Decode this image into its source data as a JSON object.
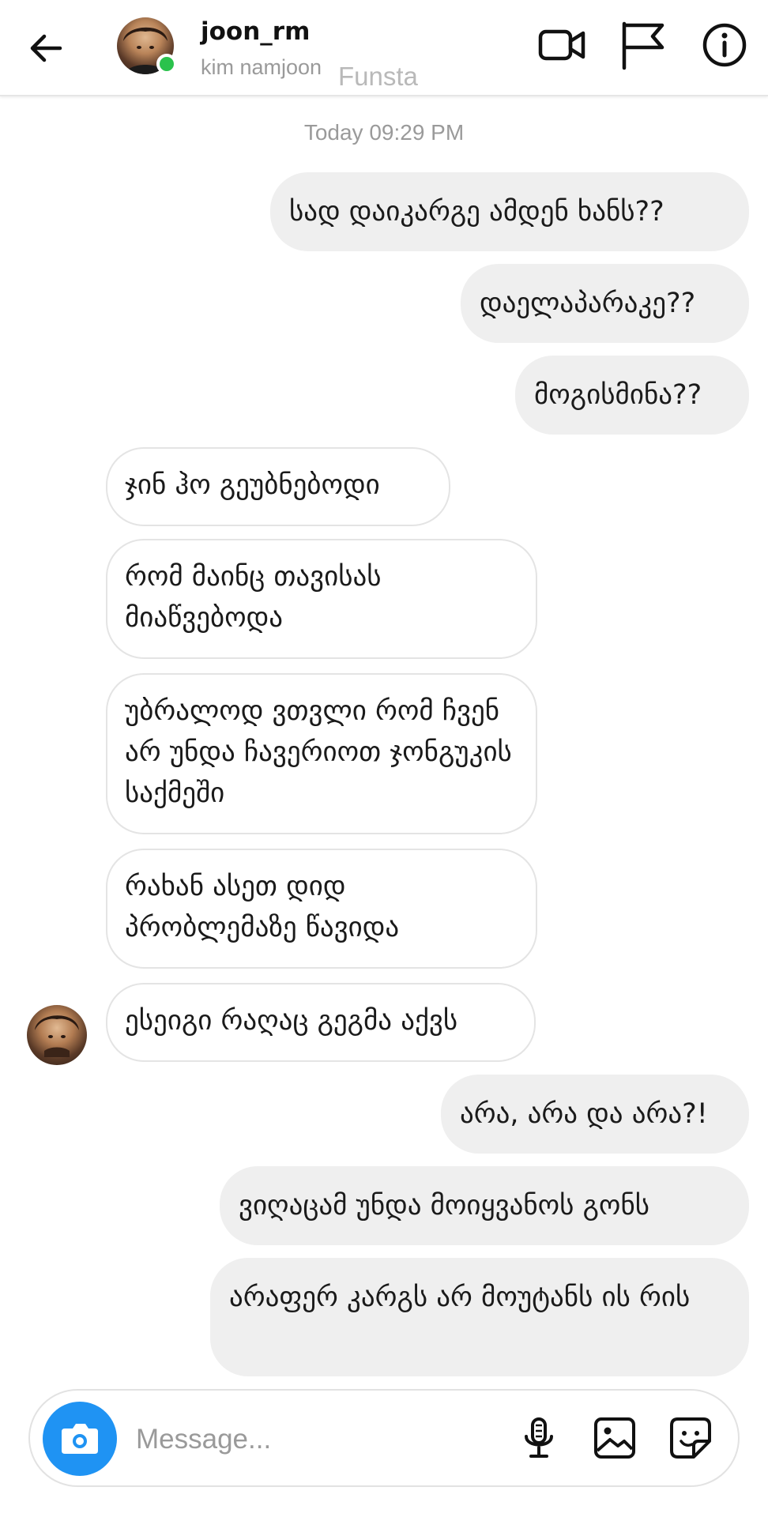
{
  "header": {
    "username": "joon_rm",
    "full_name": "kim namjoon",
    "watermark": "Funsta",
    "online_color": "#2ac24c",
    "icons": [
      "back-arrow-icon",
      "video-camera-icon",
      "flag-icon",
      "info-icon"
    ]
  },
  "conversation": {
    "timestamp": "Today 09:29 PM",
    "messages": [
      {
        "direction": "sent",
        "text": "სად დაიკარგე ამდენ ხანს??"
      },
      {
        "direction": "sent",
        "text": "დაელაპარაკე??"
      },
      {
        "direction": "sent",
        "text": "მოგისმინა??"
      },
      {
        "direction": "received",
        "text": "ჯინ ჰო გეუბნებოდი"
      },
      {
        "direction": "received",
        "text": "რომ მაინც თავისას მიაწვებოდა"
      },
      {
        "direction": "received",
        "text": "უბრალოდ ვთვლი რომ ჩვენ არ უნდა ჩავერიოთ ჯონგუკის საქმეში"
      },
      {
        "direction": "received",
        "text": "რახან ასეთ დიდ პრობლემაზე წავიდა"
      },
      {
        "direction": "received",
        "text": "ესეიგი რაღაც გეგმა აქვს"
      },
      {
        "direction": "sent",
        "text": "არა, არა და არა?!"
      },
      {
        "direction": "sent",
        "text": "ვიღაცამ უნდა მოიყვანოს გონს"
      },
      {
        "direction": "sent",
        "text": "არაფერ კარგს არ მოუტანს ის რის"
      }
    ]
  },
  "composer": {
    "placeholder": "Message...",
    "camera_color": "#1f93f3",
    "icons": [
      "camera-icon",
      "microphone-icon",
      "gallery-icon",
      "sticker-icon"
    ]
  }
}
